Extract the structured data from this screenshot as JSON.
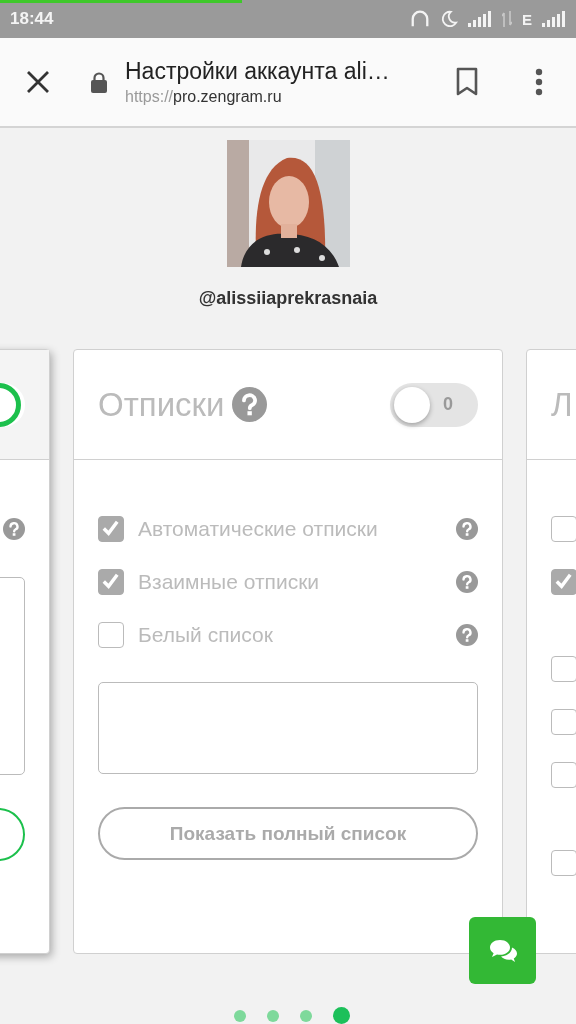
{
  "status_bar": {
    "time": "18:44",
    "network_type": "E"
  },
  "page_load": {
    "level": 0.42
  },
  "toolbar": {
    "title": "Настройки аккаунта ali…",
    "url_scheme": "https://",
    "url_host": "pro.zengram.ru"
  },
  "profile": {
    "username": "@alissiiaprekrasnaia"
  },
  "cards": [
    {
      "toggle": {
        "on": true
      },
      "options": [
        {
          "help": true
        }
      ],
      "list_field": true,
      "show_button": true
    },
    {
      "title": "Отписки",
      "title_help": true,
      "toggle": {
        "on": false,
        "label": "0"
      },
      "options": [
        {
          "label": "Автоматические отписки",
          "checked": true,
          "help": true
        },
        {
          "label": "Взаимные отписки",
          "checked": true,
          "help": true
        },
        {
          "label": "Белый список",
          "checked": false,
          "help": true
        }
      ],
      "list_field": true,
      "button": {
        "label": "Показать полный список"
      }
    },
    {
      "title": "Л",
      "options": [
        {
          "checked": false
        },
        {
          "checked": true
        },
        {
          "checked": false
        },
        {
          "checked": false
        },
        {
          "checked": false
        },
        {
          "checked": false
        }
      ]
    }
  ],
  "pager": [
    {
      "selected": false
    },
    {
      "selected": false
    },
    {
      "selected": false
    },
    {
      "selected": true
    }
  ],
  "chat_button": true
}
